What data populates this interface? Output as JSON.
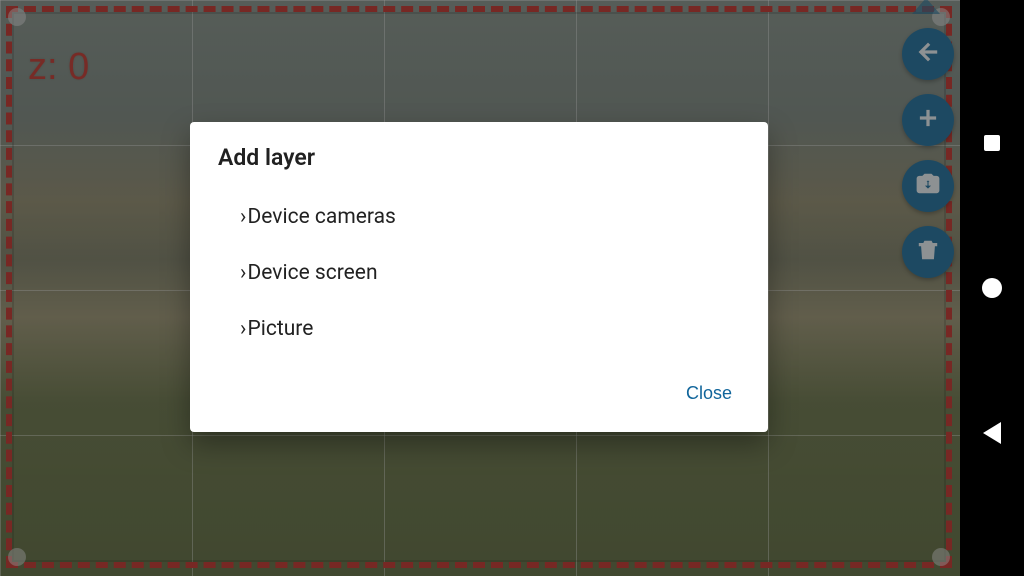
{
  "z_label": "z: 0",
  "dialog": {
    "title": "Add layer",
    "options": [
      "Device cameras",
      "Device screen",
      "Picture"
    ],
    "close": "Close"
  },
  "fabs": [
    "back",
    "add",
    "swap-camera",
    "delete"
  ],
  "accent_color": "#1d6c99",
  "selection_color": "#c03028"
}
